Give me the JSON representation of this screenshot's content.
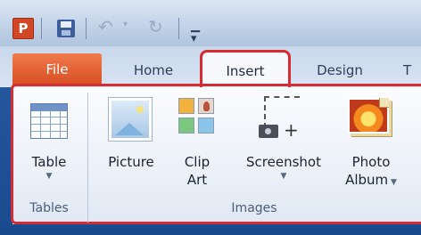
{
  "quick_access": {
    "app_logo": "P",
    "icons": [
      "powerpoint-logo-icon",
      "save-icon",
      "undo-icon",
      "redo-icon",
      "customize-toolbar-icon"
    ]
  },
  "tabs": [
    {
      "label": "File"
    },
    {
      "label": "Home"
    },
    {
      "label": "Insert"
    },
    {
      "label": "Design"
    },
    {
      "label": "T"
    }
  ],
  "active_tab": "Insert",
  "ribbon": {
    "groups": [
      {
        "label": "Tables",
        "commands": [
          {
            "label": "Table",
            "has_dropdown": true
          }
        ]
      },
      {
        "label": "Images",
        "commands": [
          {
            "label": "Picture"
          },
          {
            "label_line1": "Clip",
            "label_line2": "Art"
          },
          {
            "label": "Screenshot",
            "has_dropdown": true
          },
          {
            "label_line1": "Photo",
            "label_line2": "Album",
            "has_dropdown": true
          }
        ]
      }
    ]
  },
  "colors": {
    "highlight": "#d82c33",
    "file_tab": "#e35f2f",
    "frame": "#1c4d94"
  }
}
